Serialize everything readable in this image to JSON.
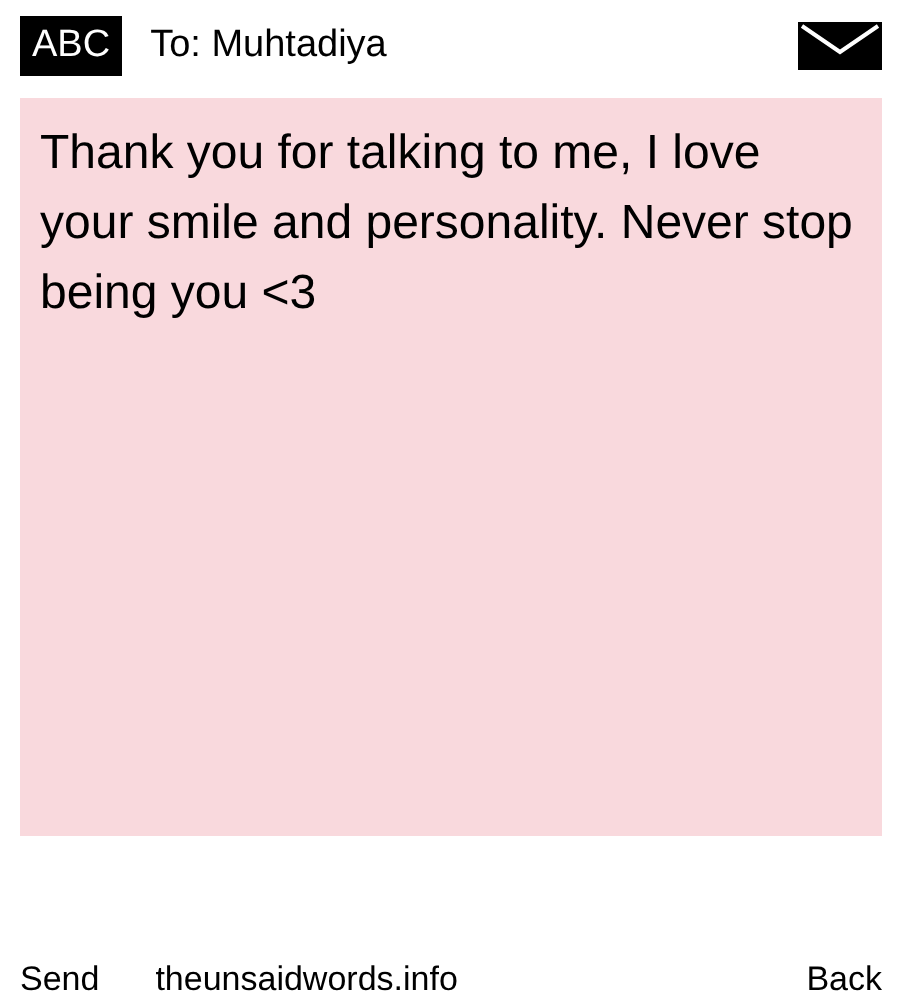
{
  "header": {
    "badge": "ABC",
    "recipient": "To: Muhtadiya"
  },
  "message": {
    "text": "Thank you for talking to me, I love your smile and personality. Never stop being you <3"
  },
  "footer": {
    "send": "Send",
    "site": "theunsaidwords.info",
    "back": "Back"
  }
}
